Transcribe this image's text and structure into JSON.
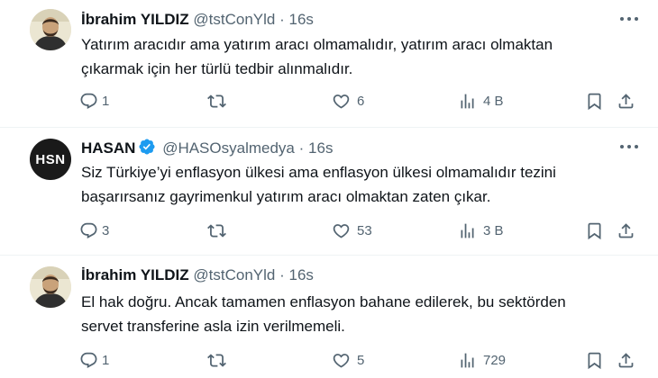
{
  "tweets": [
    {
      "name": "İbrahim YILDIZ",
      "handle": "@tstConYld",
      "separator": "·",
      "time": "16s",
      "verified": false,
      "avatar": "person-photo",
      "lines": [
        "Yatırım aracıdır ama yatırım aracı olmamalıdır, yatırım aracı olmaktan",
        "çıkarmak için her türlü tedbir alınmalıdır."
      ],
      "replies": "1",
      "retweets": "",
      "likes": "6",
      "views": "4 B"
    },
    {
      "name": "HASAN",
      "handle": "@HASOsyalmedya",
      "separator": "·",
      "time": "16s",
      "verified": true,
      "avatar": "HSN",
      "lines": [
        "Siz Türkiye’yi enflasyon ülkesi ama enflasyon ülkesi olmamalıdır tezini",
        "başarırsanız gayrimenkul yatırım aracı olmaktan zaten çıkar."
      ],
      "replies": "3",
      "retweets": "",
      "likes": "53",
      "views": "3 B"
    },
    {
      "name": "İbrahim YILDIZ",
      "handle": "@tstConYld",
      "separator": "·",
      "time": "16s",
      "verified": false,
      "avatar": "person-photo",
      "lines": [
        "El hak doğru. Ancak tamamen enflasyon bahane edilerek, bu sektörden",
        "servet transferine asla izin verilmemeli."
      ],
      "replies": "1",
      "retweets": "",
      "likes": "5",
      "views": "729"
    }
  ],
  "colors": {
    "text": "#0f1419",
    "secondary": "#536471",
    "verified": "#1d9bf0",
    "divider": "#eff3f4"
  },
  "icons": [
    "reply-icon",
    "retweet-icon",
    "like-icon",
    "views-icon",
    "bookmark-icon",
    "share-icon",
    "more-icon",
    "verified-badge-icon"
  ]
}
